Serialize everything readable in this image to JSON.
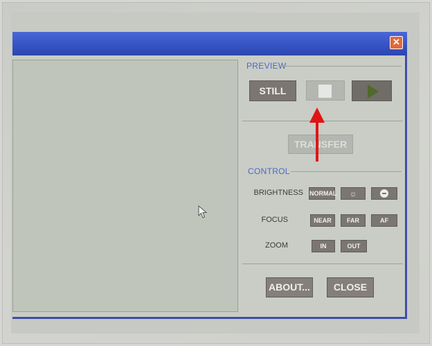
{
  "window": {
    "close_glyph": "✕"
  },
  "preview": {
    "section_label": "PREVIEW",
    "still_label": "STILL",
    "stop_icon": "stop-square",
    "play_icon": "play-triangle",
    "transfer_label": "TRANSFER"
  },
  "control": {
    "section_label": "CONTROL",
    "brightness_label": "BRIGHTNESS",
    "brightness_normal": "NORMAL",
    "brightness_up_icon": "sun-icon",
    "brightness_down_icon": "minus-circle-icon",
    "focus_label": "FOCUS",
    "focus_near": "NEAR",
    "focus_far": "FAR",
    "focus_af": "AF",
    "zoom_label": "ZOOM",
    "zoom_in": "IN",
    "zoom_out": "OUT"
  },
  "footer": {
    "about_label": "ABOUT...",
    "close_label": "CLOSE"
  },
  "colors": {
    "annotation_arrow": "#e01515",
    "titlebar": "#3552c4",
    "button": "#7b7672"
  }
}
